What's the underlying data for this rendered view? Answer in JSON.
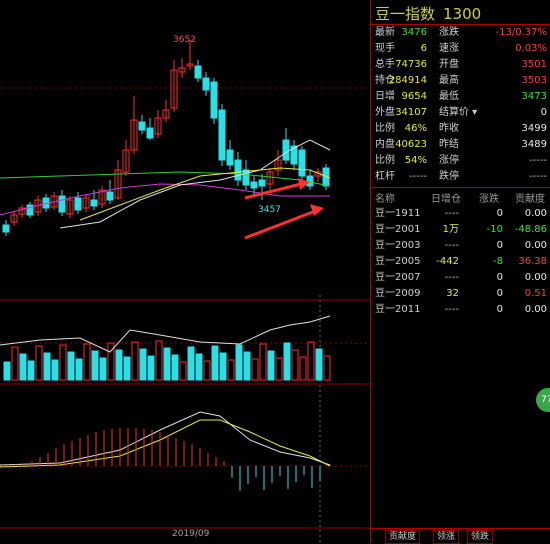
{
  "panel": {
    "title": "豆一指数",
    "code": "1300",
    "quote_rows": [
      {
        "l1": "最新",
        "v1": "3476",
        "c1": "green",
        "l2": "涨跌",
        "v2": "-13/0.37%",
        "c2": "red"
      },
      {
        "l1": "现手",
        "v1": "6",
        "c1": "yellow",
        "l2": "速涨",
        "v2": "0.03%",
        "c2": "red"
      },
      {
        "l1": "总手",
        "v1": "74736",
        "c1": "yellow",
        "l2": "开盘",
        "v2": "3501",
        "c2": "red"
      },
      {
        "l1": "持仓",
        "v1": "284914",
        "c1": "yellow",
        "l2": "最高",
        "v2": "3503",
        "c2": "red"
      },
      {
        "l1": "日增",
        "v1": "9654",
        "c1": "yellow",
        "l2": "最低",
        "v2": "3473",
        "c2": "green"
      },
      {
        "l1": "外盘",
        "v1": "34107",
        "c1": "yellow",
        "l2": "结算价 ▾",
        "v2": "0",
        "c2": "white"
      },
      {
        "l1": "比例",
        "v1": "46%",
        "c1": "yellow",
        "l2": "昨收",
        "v2": "3499",
        "c2": "white"
      },
      {
        "l1": "内盘",
        "v1": "40623",
        "c1": "yellow",
        "l2": "昨结",
        "v2": "3489",
        "c2": "white"
      },
      {
        "l1": "比例",
        "v1": "54%",
        "c1": "yellow",
        "l2": "涨停",
        "v2": "-----",
        "c2": "gray"
      },
      {
        "l1": "杠杆",
        "v1": "-----",
        "c1": "gray",
        "l2": "跌停",
        "v2": "-----",
        "c2": "gray"
      }
    ],
    "list_headers": [
      "名称",
      "日增仓",
      "涨跌",
      "贡献度"
    ],
    "list_rows": [
      {
        "name": "豆一1911",
        "oi": "----",
        "oc": "gray",
        "chg": "0",
        "cc": "white",
        "contrib": "0.00",
        "bc": "white"
      },
      {
        "name": "豆一2001",
        "oi": "1万",
        "oc": "yellow",
        "chg": "-10",
        "cc": "green",
        "contrib": "-48.86",
        "bc": "green"
      },
      {
        "name": "豆一2003",
        "oi": "----",
        "oc": "gray",
        "chg": "0",
        "cc": "white",
        "contrib": "0.00",
        "bc": "white"
      },
      {
        "name": "豆一2005",
        "oi": "-442",
        "oc": "yellow",
        "chg": "-8",
        "cc": "green",
        "contrib": "36.38",
        "bc": "red"
      },
      {
        "name": "豆一2007",
        "oi": "----",
        "oc": "gray",
        "chg": "0",
        "cc": "white",
        "contrib": "0.00",
        "bc": "white"
      },
      {
        "name": "豆一2009",
        "oi": "32",
        "oc": "yellow",
        "chg": "0",
        "cc": "white",
        "contrib": "0.51",
        "bc": "red"
      },
      {
        "name": "豆一2011",
        "oi": "----",
        "oc": "gray",
        "chg": "0",
        "cc": "white",
        "contrib": "0.00",
        "bc": "white"
      }
    ],
    "tabs": [
      "贡献度",
      "领涨",
      "领跌"
    ]
  },
  "chart": {
    "high_label": "3652",
    "low_label": "3457",
    "date_label": "2019/09",
    "float_button": "77"
  },
  "colors": {
    "up": "#ff2a2a",
    "down": "#28e0e6",
    "grid": "#8a0000"
  }
}
